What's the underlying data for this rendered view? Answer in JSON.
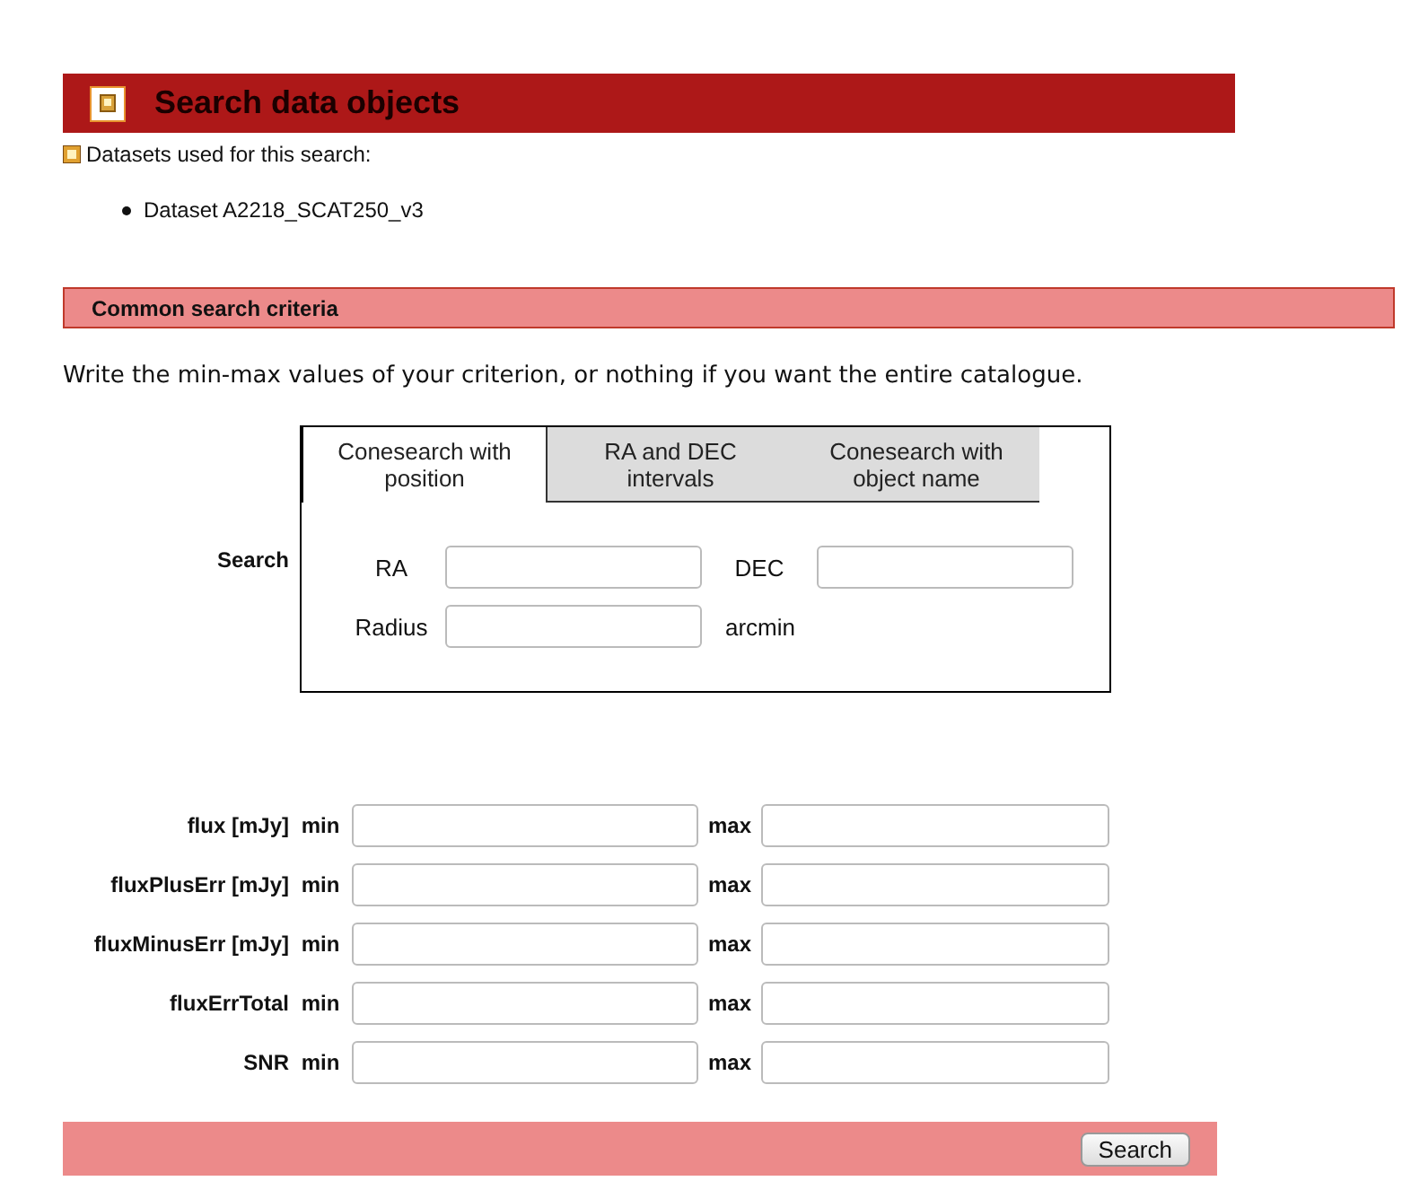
{
  "header": {
    "title": "Search data objects"
  },
  "datasets": {
    "label": "Datasets used for this search:",
    "items": [
      "Dataset A2218_SCAT250_v3"
    ]
  },
  "section": {
    "title": "Common search criteria"
  },
  "instruction": "Write the min-max values of your criterion, or nothing if you want the entire catalogue.",
  "search": {
    "label": "Search",
    "tabs": [
      {
        "label": "Conesearch with position",
        "selected": true
      },
      {
        "label": "RA and DEC intervals",
        "selected": false
      },
      {
        "label": "Conesearch with object name",
        "selected": false
      }
    ],
    "fields": [
      {
        "label": "RA"
      },
      {
        "label": "DEC"
      },
      {
        "label": "Radius",
        "unit": "arcmin"
      }
    ]
  },
  "criteria": [
    {
      "name": "flux [mJy]",
      "min_label": "min",
      "max_label": "max"
    },
    {
      "name": "fluxPlusErr [mJy]",
      "min_label": "min",
      "max_label": "max"
    },
    {
      "name": "fluxMinusErr [mJy]",
      "min_label": "min",
      "max_label": "max"
    },
    {
      "name": "fluxErrTotal",
      "min_label": "min",
      "max_label": "max"
    },
    {
      "name": "SNR",
      "min_label": "min",
      "max_label": "max"
    }
  ],
  "submit": "Search"
}
